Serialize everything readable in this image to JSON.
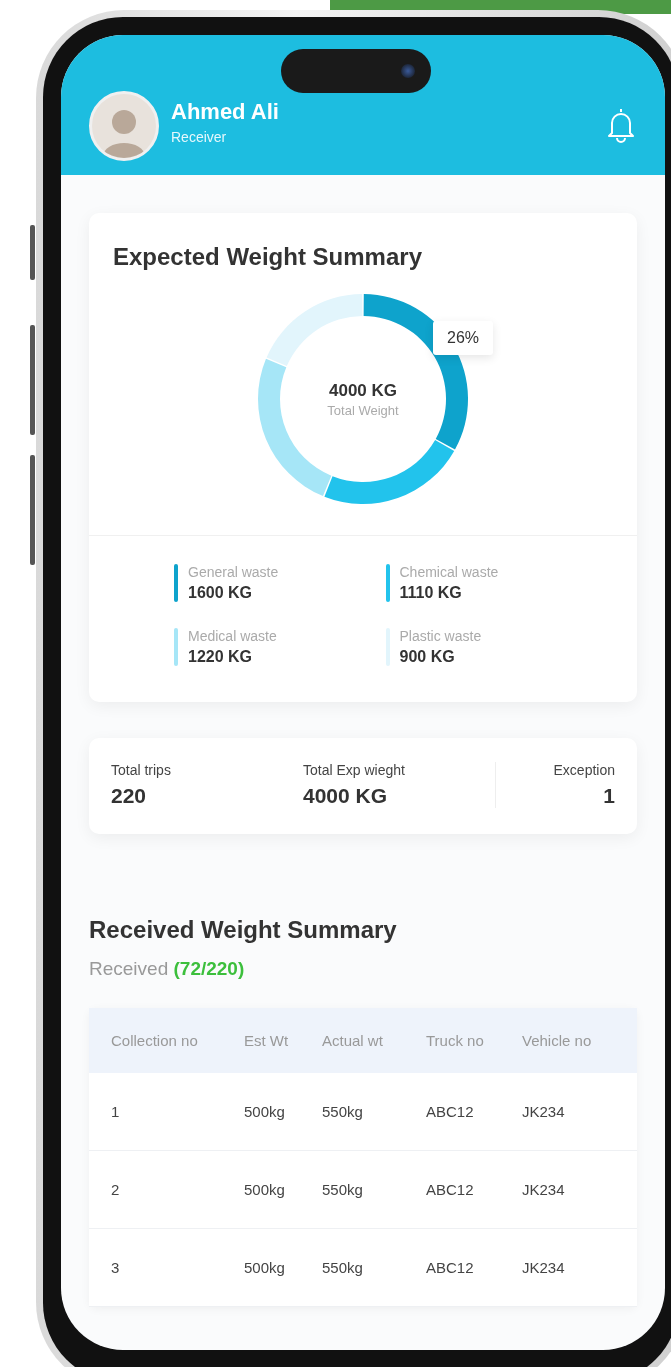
{
  "user": {
    "name": "Ahmed Ali",
    "role": "Receiver"
  },
  "expected": {
    "title": "Expected Weight Summary",
    "total": "4000 KG",
    "total_label": "Total Weight",
    "tooltip": "26%",
    "legend": [
      {
        "label": "General waste",
        "value": "1600 KG",
        "color": "#0ea3cc"
      },
      {
        "label": "Chemical waste",
        "value": "1110 KG",
        "color": "#22c3ec"
      },
      {
        "label": "Medical waste",
        "value": "1220 KG",
        "color": "#a6e6f7"
      },
      {
        "label": "Plastic waste",
        "value": "900 KG",
        "color": "#e2f5fc"
      }
    ]
  },
  "stats": [
    {
      "label": "Total trips",
      "value": "220"
    },
    {
      "label": "Total Exp wieght",
      "value": "4000 KG"
    },
    {
      "label": "Exception",
      "value": "1"
    }
  ],
  "received": {
    "title": "Received Weight Summary",
    "subtitle": "Received **(72/220)**",
    "table": {
      "columns": [
        "Collection no",
        "Est Wt",
        "Actual wt",
        "Truck no",
        "Vehicle no"
      ],
      "rows": [
        [
          "1",
          "500kg",
          "550kg",
          "ABC12",
          "JK234"
        ],
        [
          "2",
          "500kg",
          "550kg",
          "ABC12",
          "JK234"
        ],
        [
          "3",
          "500kg",
          "550kg",
          "ABC12",
          "JK234"
        ]
      ]
    }
  }
}
